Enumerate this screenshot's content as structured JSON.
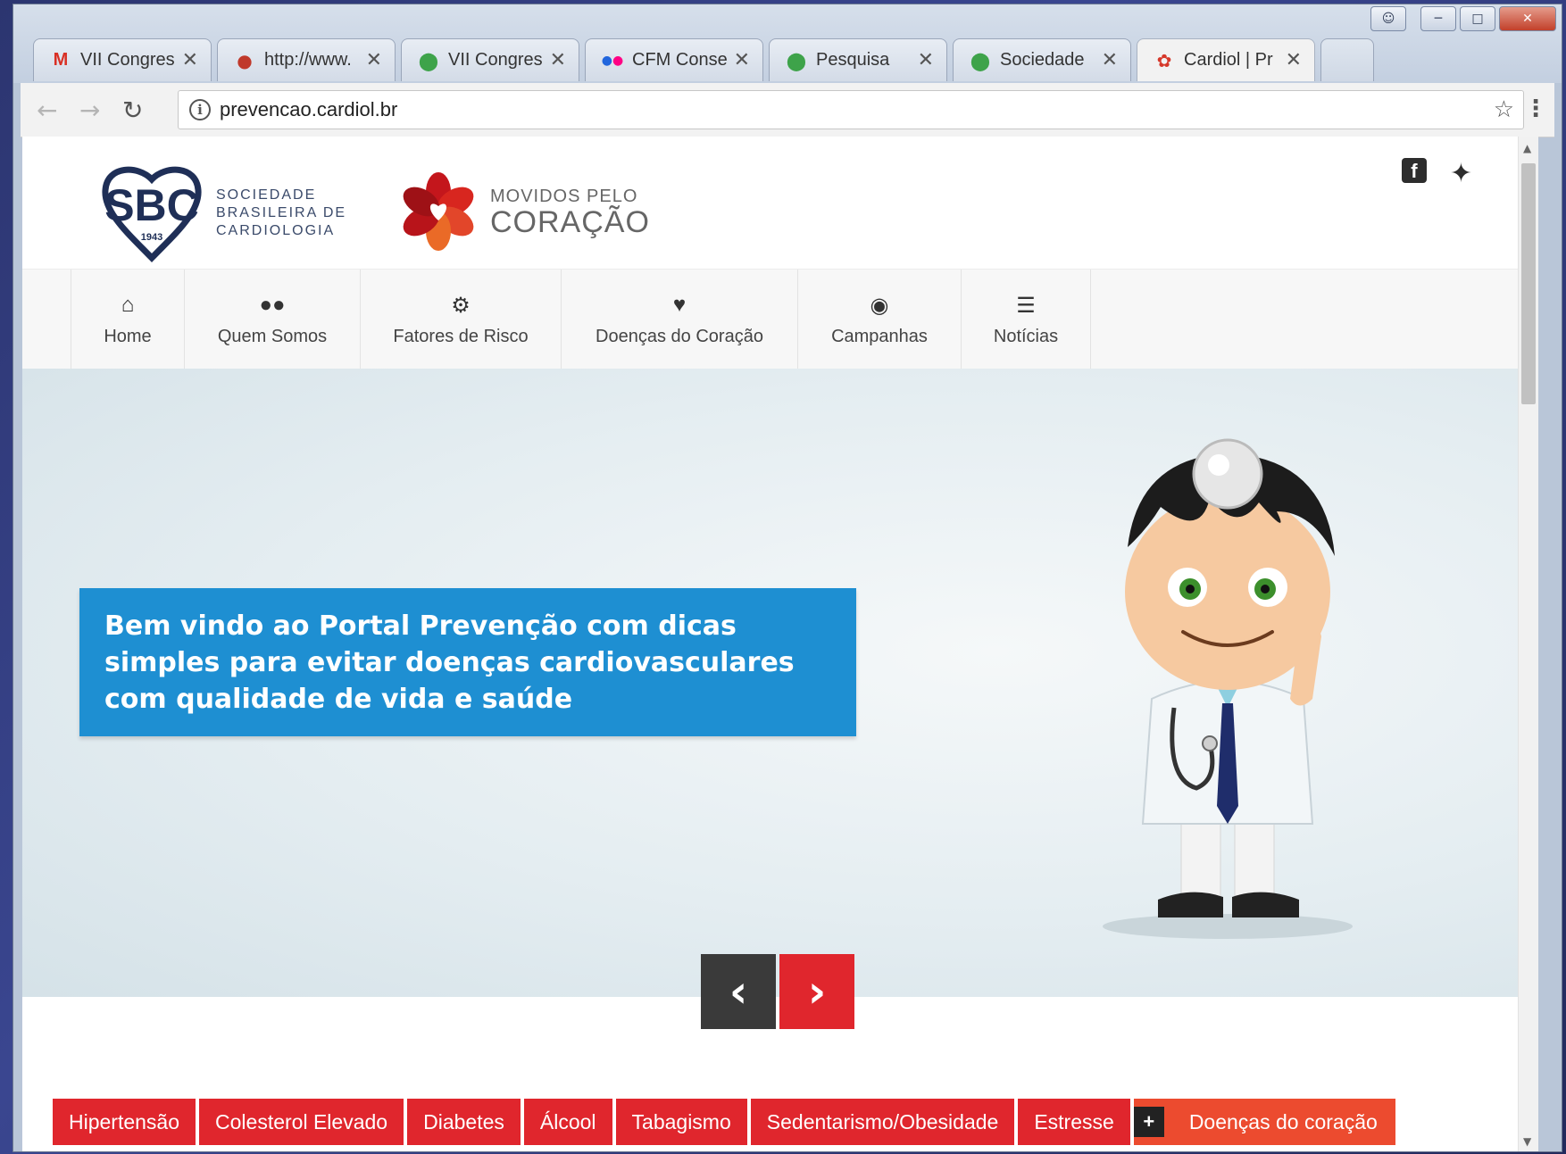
{
  "browser": {
    "tabs": [
      {
        "title": "VII Congres",
        "favicon": "gmail-icon"
      },
      {
        "title": "http://www.",
        "favicon": "profile-icon"
      },
      {
        "title": "VII Congres",
        "favicon": "shield-icon"
      },
      {
        "title": "CFM Conse",
        "favicon": "flickr-icon"
      },
      {
        "title": "Pesquisa",
        "favicon": "shield-icon"
      },
      {
        "title": "Sociedade",
        "favicon": "shield-icon"
      },
      {
        "title": "Cardiol | Pr",
        "favicon": "flower-heart-icon",
        "active": true
      }
    ],
    "url": "prevencao.cardiol.br"
  },
  "header": {
    "sbc": {
      "abbr": "SBC",
      "year": "1943",
      "line1": "SOCIEDADE",
      "line2": "BRASILEIRA DE",
      "line3": "CARDIOLOGIA"
    },
    "campaign": {
      "line1": "MOVIDOS PELO",
      "line2": "CORAÇÃO"
    }
  },
  "nav": [
    {
      "label": "Home",
      "icon": "home-icon"
    },
    {
      "label": "Quem Somos",
      "icon": "users-icon"
    },
    {
      "label": "Fatores de Risco",
      "icon": "gears-icon"
    },
    {
      "label": "Doenças do Coração",
      "icon": "heart-icon"
    },
    {
      "label": "Campanhas",
      "icon": "globe-icon"
    },
    {
      "label": "Notícias",
      "icon": "list-icon"
    }
  ],
  "hero": {
    "text": "Bem vindo ao Portal Prevenção com dicas simples para evitar doenças cardiovasculares com qualidade de vida e saúde"
  },
  "categories": [
    "Hipertensão",
    "Colesterol Elevado",
    "Diabetes",
    "Álcool",
    "Tabagismo",
    "Sedentarismo/Obesidade",
    "Estresse"
  ],
  "more_category": {
    "plus": "+",
    "label": "Doenças do coração"
  },
  "colors": {
    "accent_red": "#e0262d",
    "hero_blue": "#1e8fd2",
    "navy": "#1f2f57"
  }
}
